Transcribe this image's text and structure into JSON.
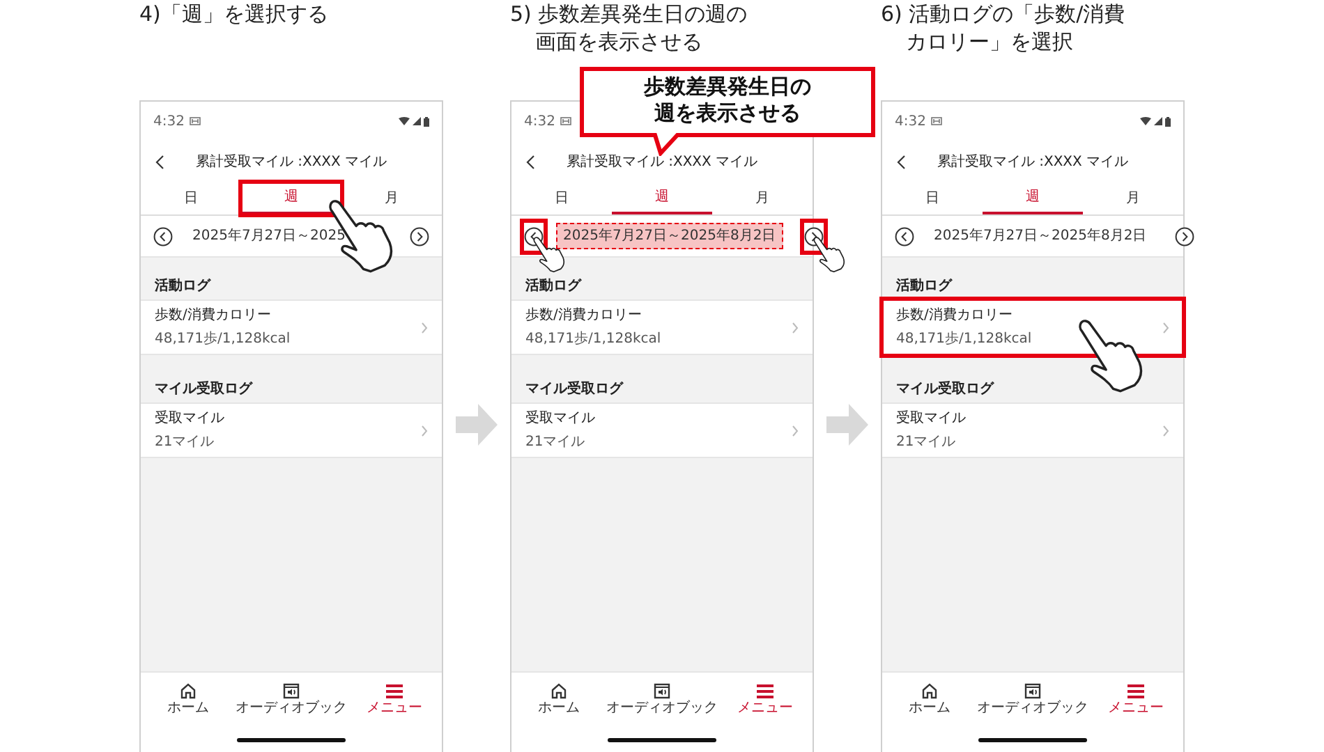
{
  "steps": [
    {
      "caption": [
        "4)「週」を選択する"
      ],
      "screen": {
        "time": "4:32",
        "title": "累計受取マイル :XXXX マイル",
        "tabs": [
          {
            "label": "日",
            "selected": false,
            "highlighted": false
          },
          {
            "label": "週",
            "selected": true,
            "highlighted": true
          },
          {
            "label": "月",
            "selected": false,
            "highlighted": false
          }
        ],
        "date_nav": {
          "range": "2025年7月27日～2025",
          "highlighted": false,
          "buttons_highlighted": false
        },
        "sections": [
          {
            "heading": "活動ログ",
            "items": [
              {
                "title": "歩数/消費カロリー",
                "value": "48,171歩/1,128kcal",
                "highlighted": false
              }
            ]
          },
          {
            "heading": "マイル受取ログ",
            "items": [
              {
                "title": "受取マイル",
                "value": "21マイル",
                "highlighted": false
              }
            ]
          }
        ],
        "nav": [
          {
            "label": "ホーム",
            "kind": "home",
            "selected": false
          },
          {
            "label": "オーディオブック",
            "kind": "audiobook",
            "selected": false
          },
          {
            "label": "メニュー",
            "kind": "menu",
            "selected": true
          }
        ]
      }
    },
    {
      "caption": [
        "5) 歩数差異発生日の週の",
        "画面を表示させる"
      ],
      "callout": [
        "歩数差異発生日の",
        "週を表示させる"
      ],
      "screen": {
        "time": "4:32",
        "title": "累計受取マイル :XXXX マイル",
        "tabs": [
          {
            "label": "日",
            "selected": false,
            "highlighted": false
          },
          {
            "label": "週",
            "selected": true,
            "highlighted": false
          },
          {
            "label": "月",
            "selected": false,
            "highlighted": false
          }
        ],
        "date_nav": {
          "range": "2025年7月27日～2025年8月2日",
          "highlighted": true,
          "buttons_highlighted": true
        },
        "sections": [
          {
            "heading": "活動ログ",
            "items": [
              {
                "title": "歩数/消費カロリー",
                "value": "48,171歩/1,128kcal",
                "highlighted": false
              }
            ]
          },
          {
            "heading": "マイル受取ログ",
            "items": [
              {
                "title": "受取マイル",
                "value": "21マイル",
                "highlighted": false
              }
            ]
          }
        ],
        "nav": [
          {
            "label": "ホーム",
            "kind": "home",
            "selected": false
          },
          {
            "label": "オーディオブック",
            "kind": "audiobook",
            "selected": false
          },
          {
            "label": "メニュー",
            "kind": "menu",
            "selected": true
          }
        ]
      }
    },
    {
      "caption": [
        "6) 活動ログの「歩数/消費",
        "カロリー」を選択"
      ],
      "screen": {
        "time": "4:32",
        "title": "累計受取マイル :XXXX マイル",
        "tabs": [
          {
            "label": "日",
            "selected": false,
            "highlighted": false
          },
          {
            "label": "週",
            "selected": true,
            "highlighted": false
          },
          {
            "label": "月",
            "selected": false,
            "highlighted": false
          }
        ],
        "date_nav": {
          "range": "2025年7月27日～2025年8月2日",
          "highlighted": false,
          "buttons_highlighted": false
        },
        "sections": [
          {
            "heading": "活動ログ",
            "items": [
              {
                "title": "歩数/消費カロリー",
                "value": "48,171歩/1,128kcal",
                "highlighted": true
              }
            ]
          },
          {
            "heading": "マイル受取ログ",
            "items": [
              {
                "title": "受取マイル",
                "value": "21マイル",
                "highlighted": false
              }
            ]
          }
        ],
        "nav": [
          {
            "label": "ホーム",
            "kind": "home",
            "selected": false
          },
          {
            "label": "オーディオブック",
            "kind": "audiobook",
            "selected": false
          },
          {
            "label": "メニュー",
            "kind": "menu",
            "selected": true
          }
        ]
      }
    }
  ]
}
